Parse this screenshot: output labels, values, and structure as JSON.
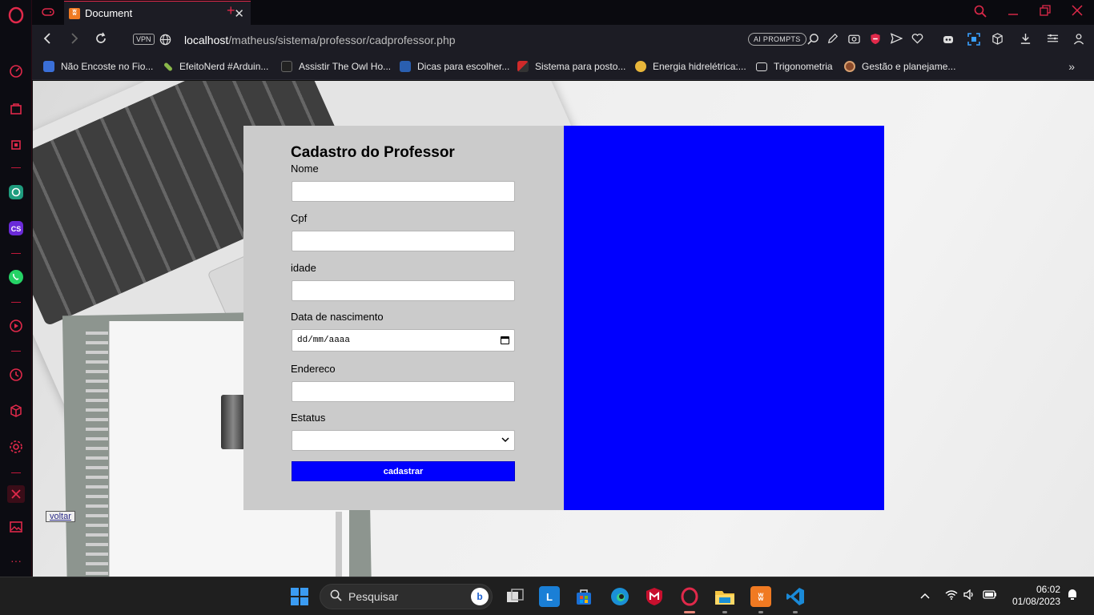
{
  "browser": {
    "tab_title": "Document",
    "tab_close": "✕",
    "new_tab": "+",
    "vpn_label": "VPN",
    "url_host": "localhost",
    "url_path": "/matheus/sistema/professor/cadprofessor.php",
    "ai_prompts_label": "AI PROMPTS",
    "bookmarks": [
      "Não Encoste no Fio...",
      "EfeitoNerd #Arduin...",
      "Assistir The Owl Ho...",
      "Dicas para escolher...",
      "Sistema para posto...",
      "Energia hidrelétrica:...",
      "Trigonometria",
      "Gestão e planejame..."
    ],
    "bookmarks_more": "»"
  },
  "form": {
    "title": "Cadastro do Professor",
    "nome_label": "Nome",
    "cpf_label": "Cpf",
    "idade_label": "idade",
    "nascimento_label": "Data de nascimento",
    "nascimento_placeholder": "dd/mm/aaaa",
    "endereco_label": "Endereco",
    "estatus_label": "Estatus",
    "submit_label": "cadastrar",
    "colors": {
      "card": "#cbcbcb",
      "accent": "#0000ff"
    }
  },
  "page": {
    "voltar_label": "voltar"
  },
  "taskbar": {
    "search_placeholder": "Pesquisar",
    "time": "06:02",
    "date": "01/08/2023"
  }
}
